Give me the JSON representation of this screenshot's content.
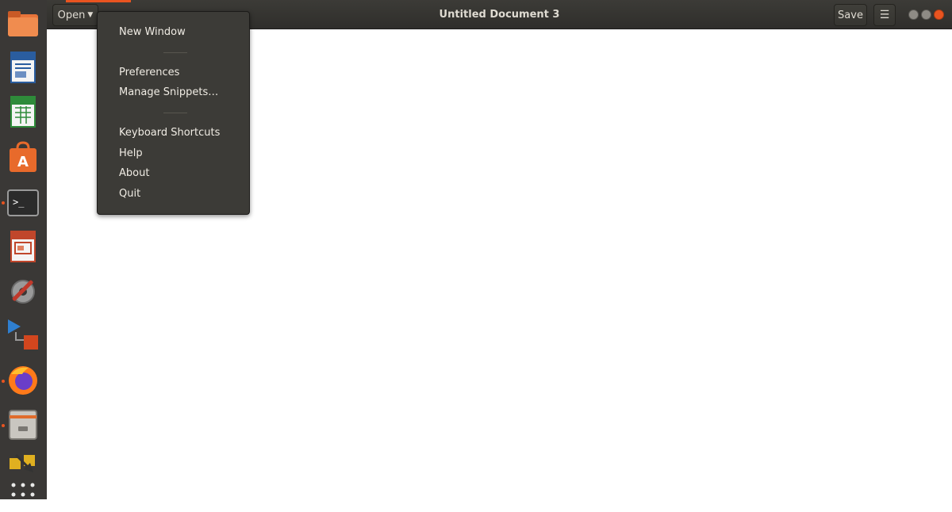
{
  "window": {
    "title": "Untitled Document 3"
  },
  "toolbar": {
    "open_label": "Open",
    "save_label": "Save"
  },
  "menu": {
    "items": [
      {
        "label": "New Window"
      },
      {
        "label": "Preferences"
      },
      {
        "label": "Manage Snippets…"
      },
      {
        "label": "Keyboard Shortcuts"
      },
      {
        "label": "Help"
      },
      {
        "label": "About"
      },
      {
        "label": "Quit"
      }
    ]
  },
  "dock": {
    "items": [
      {
        "icon": "files-icon"
      },
      {
        "icon": "libreoffice-writer-icon"
      },
      {
        "icon": "libreoffice-calc-icon"
      },
      {
        "icon": "software-center-icon"
      },
      {
        "icon": "terminal-icon",
        "running": true
      },
      {
        "icon": "libreoffice-impress-icon"
      },
      {
        "icon": "settings-tools-icon"
      },
      {
        "icon": "virtual-machine-icon"
      },
      {
        "icon": "firefox-icon",
        "running": true
      },
      {
        "icon": "archive-manager-icon",
        "running": true
      },
      {
        "icon": "file-transfer-icon"
      },
      {
        "icon": "show-applications-icon"
      }
    ]
  },
  "colors": {
    "accent": "#e95420",
    "headerbar": "#3c3b37",
    "dock": "#3a3836"
  }
}
